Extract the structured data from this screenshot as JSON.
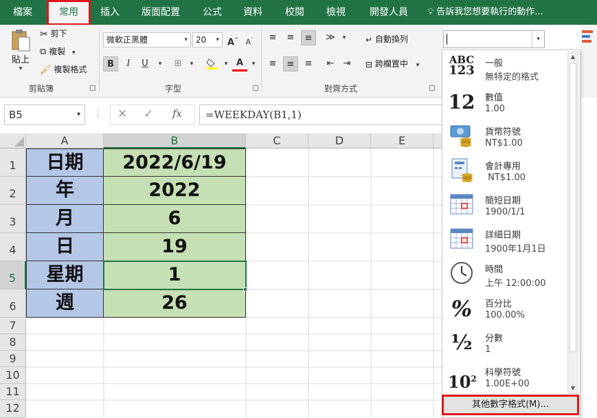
{
  "ribbon_tabs": [
    "檔案",
    "常用",
    "插入",
    "版面配置",
    "公式",
    "資料",
    "校閱",
    "檢視",
    "開發人員"
  ],
  "tell_me": "告訴我您想要執行的動作...",
  "clipboard": {
    "paste": "貼上",
    "cut": "剪下",
    "copy": "複製",
    "format_painter": "複製格式",
    "group_label": "剪貼簿"
  },
  "font": {
    "name": "微軟正黑體",
    "size": "20",
    "group_label": "字型",
    "bold": "B",
    "italic": "I",
    "underline": "U"
  },
  "alignment": {
    "wrap_text": "自動換列",
    "merge_center": "跨欄置中",
    "group_label": "對齊方式"
  },
  "formula_bar": {
    "name_box": "B5",
    "formula": "=WEEKDAY(B1,1)"
  },
  "columns": [
    "A",
    "B",
    "C",
    "D",
    "E"
  ],
  "rows": [
    "1",
    "2",
    "3",
    "4",
    "5",
    "6",
    "7",
    "8",
    "9",
    "10",
    "11",
    "12"
  ],
  "cells": {
    "A": [
      "日期",
      "年",
      "月",
      "日",
      "星期",
      "週"
    ],
    "B": [
      "2022/6/19",
      "2022",
      "6",
      "19",
      "1",
      "26"
    ]
  },
  "number_format_box": "",
  "number_formats": [
    {
      "name": "一般",
      "example": "無特定的格式",
      "icon": "abc-123-icon"
    },
    {
      "name": "數值",
      "example": "1.00",
      "icon": "number-12-icon"
    },
    {
      "name": "貨幣符號",
      "example": "NT$1.00",
      "icon": "currency-icon"
    },
    {
      "name": "會計專用",
      "example": " NT$1.00",
      "icon": "accounting-icon"
    },
    {
      "name": "簡短日期",
      "example": "1900/1/1",
      "icon": "calendar-icon"
    },
    {
      "name": "詳細日期",
      "example": "1900年1月1日",
      "icon": "calendar-icon"
    },
    {
      "name": "時間",
      "example": "上午 12:00:00",
      "icon": "clock-icon"
    },
    {
      "name": "百分比",
      "example": "100.00%",
      "icon": "percent-icon"
    },
    {
      "name": "分數",
      "example": "1",
      "icon": "fraction-icon"
    },
    {
      "name": "科學符號",
      "example": "1.00E+00",
      "icon": "scientific-icon"
    }
  ],
  "more_formats": "其他數字格式(M)...",
  "colors": {
    "excel_green": "#217346",
    "highlight_red": "#e0161b",
    "col_a_fill": "#b4c7e7",
    "col_b_fill": "#c5e0b4"
  }
}
